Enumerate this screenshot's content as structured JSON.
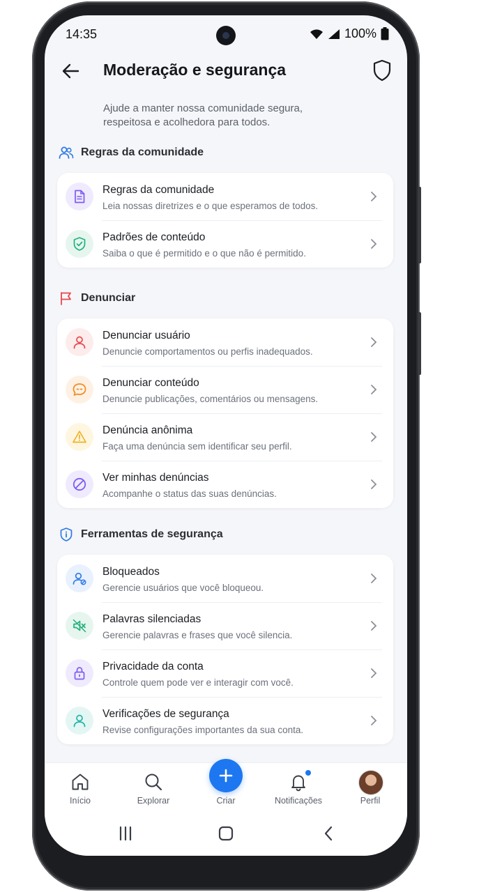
{
  "status": {
    "time": "14:35",
    "battery": "100%"
  },
  "header": {
    "title": "Moderação e segurança"
  },
  "subtitle": "Ajude a manter nossa comunidade segura, respeitosa e acolhedora para todos.",
  "sections": [
    {
      "title": "Regras da comunidade",
      "items": [
        {
          "title": "Regras da comunidade",
          "subtitle": "Leia nossas diretrizes e o que esperamos de todos."
        },
        {
          "title": "Padrões de conteúdo",
          "subtitle": "Saiba o que é permitido e o que não é permitido."
        }
      ]
    },
    {
      "title": "Denunciar",
      "items": [
        {
          "title": "Denunciar usuário",
          "subtitle": "Denuncie comportamentos ou perfis inadequados."
        },
        {
          "title": "Denunciar conteúdo",
          "subtitle": "Denuncie publicações, comentários ou mensagens."
        },
        {
          "title": "Denúncia anônima",
          "subtitle": "Faça uma denúncia sem identificar seu perfil."
        },
        {
          "title": "Ver minhas denúncias",
          "subtitle": "Acompanhe o status das suas denúncias."
        }
      ]
    },
    {
      "title": "Ferramentas de segurança",
      "items": [
        {
          "title": "Bloqueados",
          "subtitle": "Gerencie usuários que você bloqueou."
        },
        {
          "title": "Palavras silenciadas",
          "subtitle": "Gerencie palavras e frases que você silencia."
        },
        {
          "title": "Privacidade da conta",
          "subtitle": "Controle quem pode ver e interagir com você."
        },
        {
          "title": "Verificações de segurança",
          "subtitle": "Revise configurações importantes da sua conta."
        }
      ]
    }
  ],
  "nav": {
    "home": "Início",
    "explore": "Explorar",
    "create": "Criar",
    "notifications": "Notificações",
    "profile": "Perfil"
  },
  "colors": {
    "accent": "#1d77f0",
    "report": "#e5484d",
    "purple": "#7c5cf0",
    "green": "#22b07d",
    "orange": "#f28a1f",
    "amber": "#f0b323",
    "teal": "#1fb5a6"
  }
}
